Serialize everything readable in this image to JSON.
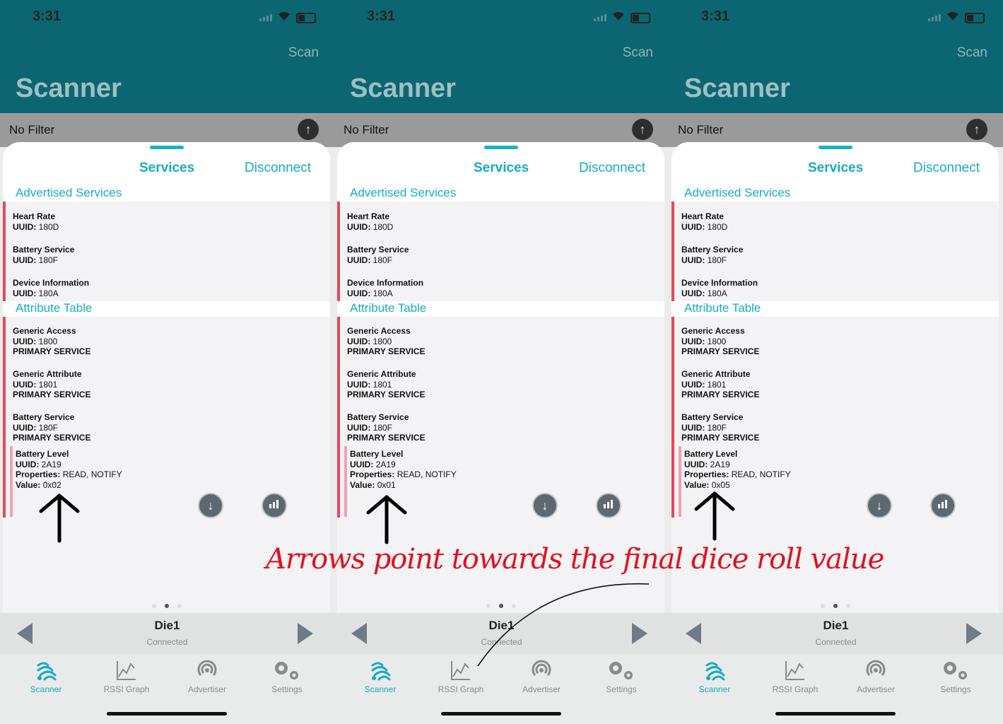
{
  "panels": [
    {
      "status_time": "3:31",
      "scan_label": "Scan",
      "title": "Scanner",
      "filter_label": "No Filter",
      "tabs": {
        "services": "Services",
        "disconnect": "Disconnect"
      },
      "advertised_header": "Advertised Services",
      "advertised": [
        {
          "name": "Heart Rate",
          "uuid_label": "UUID:",
          "uuid": " 180D"
        },
        {
          "name": "Battery Service",
          "uuid_label": "UUID:",
          "uuid": " 180F"
        },
        {
          "name": "Device Information",
          "uuid_label": "UUID:",
          "uuid": " 180A"
        }
      ],
      "attribute_header": "Attribute Table",
      "attributes": [
        {
          "name": "Generic Access",
          "uuid_label": "UUID:",
          "uuid": " 1800",
          "type": "PRIMARY SERVICE"
        },
        {
          "name": "Generic Attribute",
          "uuid_label": "UUID:",
          "uuid": " 1801",
          "type": "PRIMARY SERVICE"
        },
        {
          "name": "Battery Service",
          "uuid_label": "UUID:",
          "uuid": " 180F",
          "type": "PRIMARY SERVICE"
        }
      ],
      "characteristic": {
        "name": "Battery Level",
        "uuid_label": "UUID:",
        "uuid": " 2A19",
        "props_label": "Properties:",
        "props": " READ, NOTIFY",
        "value_label": "Value:",
        "value": " 0x02"
      },
      "device_name": "Die1",
      "device_state": "Connected",
      "tabbar": [
        "Scanner",
        "RSSI Graph",
        "Advertiser",
        "Settings"
      ]
    },
    {
      "status_time": "3:31",
      "scan_label": "Scan",
      "title": "Scanner",
      "filter_label": "No Filter",
      "tabs": {
        "services": "Services",
        "disconnect": "Disconnect"
      },
      "advertised_header": "Advertised Services",
      "advertised": [
        {
          "name": "Heart Rate",
          "uuid_label": "UUID:",
          "uuid": " 180D"
        },
        {
          "name": "Battery Service",
          "uuid_label": "UUID:",
          "uuid": " 180F"
        },
        {
          "name": "Device Information",
          "uuid_label": "UUID:",
          "uuid": " 180A"
        }
      ],
      "attribute_header": "Attribute Table",
      "attributes": [
        {
          "name": "Generic Access",
          "uuid_label": "UUID:",
          "uuid": " 1800",
          "type": "PRIMARY SERVICE"
        },
        {
          "name": "Generic Attribute",
          "uuid_label": "UUID:",
          "uuid": " 1801",
          "type": "PRIMARY SERVICE"
        },
        {
          "name": "Battery Service",
          "uuid_label": "UUID:",
          "uuid": " 180F",
          "type": "PRIMARY SERVICE"
        }
      ],
      "characteristic": {
        "name": "Battery Level",
        "uuid_label": "UUID:",
        "uuid": " 2A19",
        "props_label": "Properties:",
        "props": " READ, NOTIFY",
        "value_label": "Value:",
        "value": " 0x01"
      },
      "device_name": "Die1",
      "device_state": "Connected",
      "tabbar": [
        "Scanner",
        "RSSI Graph",
        "Advertiser",
        "Settings"
      ]
    },
    {
      "status_time": "3:31",
      "scan_label": "Scan",
      "title": "Scanner",
      "filter_label": "No Filter",
      "tabs": {
        "services": "Services",
        "disconnect": "Disconnect"
      },
      "advertised_header": "Advertised Services",
      "advertised": [
        {
          "name": "Heart Rate",
          "uuid_label": "UUID:",
          "uuid": " 180D"
        },
        {
          "name": "Battery Service",
          "uuid_label": "UUID:",
          "uuid": " 180F"
        },
        {
          "name": "Device Information",
          "uuid_label": "UUID:",
          "uuid": " 180A"
        }
      ],
      "attribute_header": "Attribute Table",
      "attributes": [
        {
          "name": "Generic Access",
          "uuid_label": "UUID:",
          "uuid": " 1800",
          "type": "PRIMARY SERVICE"
        },
        {
          "name": "Generic Attribute",
          "uuid_label": "UUID:",
          "uuid": " 1801",
          "type": "PRIMARY SERVICE"
        },
        {
          "name": "Battery Service",
          "uuid_label": "UUID:",
          "uuid": " 180F",
          "type": "PRIMARY SERVICE"
        }
      ],
      "characteristic": {
        "name": "Battery Level",
        "uuid_label": "UUID:",
        "uuid": " 2A19",
        "props_label": "Properties:",
        "props": " READ, NOTIFY",
        "value_label": "Value:",
        "value": " 0x05"
      },
      "device_name": "Die1",
      "device_state": "Connected",
      "tabbar": [
        "Scanner",
        "RSSI Graph",
        "Advertiser",
        "Settings"
      ]
    }
  ],
  "annotation": "Arrows point towards the final dice roll value",
  "icons": {
    "tab_icons": [
      "scanner-icon",
      "rssi-graph-icon",
      "advertiser-icon",
      "settings-icon"
    ],
    "action_icons": [
      "download-icon",
      "graph-icon"
    ],
    "active_tab_color": "#18aac2",
    "inactive_tab_color": "#8a8a8a",
    "header_color": "#0b6672",
    "accent_color": "#18aac2",
    "annotation_color": "#e3101e"
  }
}
